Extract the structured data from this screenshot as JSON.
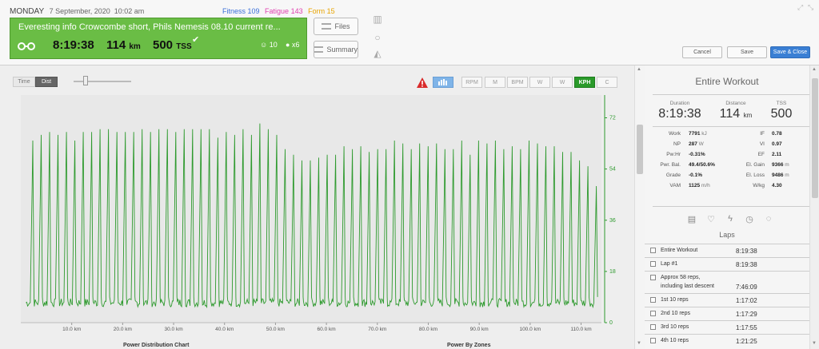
{
  "header": {
    "day": "MONDAY",
    "date": "7 September, 2020",
    "time": "10:02 am",
    "fitness_label": "Fitness 109",
    "fatigue_label": "Fatigue 143",
    "form_label": "Form 15",
    "fitness_color": "#3a6fd8",
    "fatigue_color": "#e040b0",
    "form_color": "#e8a400"
  },
  "workout": {
    "title": "Everesting info Crowcombe short, Phils Nemesis 08.10 current re...",
    "duration": "8:19:38",
    "distance": "114",
    "distance_unit": "km",
    "tss": "500",
    "tss_unit": "TSS",
    "check_mark": "✔",
    "rpe": "10",
    "comments": "x6",
    "accent_color": "#6abd45"
  },
  "buttons": {
    "files": "Files",
    "summary": "Summary",
    "cancel": "Cancel",
    "save": "Save",
    "save_close": "Save & Close"
  },
  "chart_toolbar": {
    "time": "Time",
    "dist": "Dist",
    "rpm": "RPM",
    "m": "M",
    "bpm": "BPM",
    "w1": "W",
    "w2": "W",
    "kph": "KPH",
    "c": "C"
  },
  "chart_footer": {
    "left": "Power Distribution Chart",
    "right": "Power By Zones"
  },
  "chart_data": {
    "type": "line",
    "series": [
      {
        "color": "#2e9a2e",
        "peaks_kph": [
          64,
          66,
          67,
          66,
          67,
          64,
          67,
          67,
          68,
          68,
          67,
          67,
          67,
          68,
          67,
          68,
          68,
          67,
          68,
          68,
          68,
          68,
          65,
          67,
          66,
          68,
          66,
          70,
          68,
          66,
          61,
          59,
          57,
          57,
          58,
          59,
          59,
          62,
          61,
          62,
          60,
          61,
          61,
          64,
          63,
          61,
          63,
          62,
          63,
          61,
          61,
          64,
          59,
          64,
          63,
          64,
          61,
          62,
          61,
          64,
          63,
          62,
          62,
          60,
          60,
          57,
          55,
          48
        ],
        "trough_kph": 7
      }
    ],
    "xlabel": "",
    "ylabel": "",
    "x_ticks": [
      "10.0 km",
      "20.0 km",
      "30.0 km",
      "40.0 km",
      "50.0 km",
      "60.0 km",
      "70.0 km",
      "80.0 km",
      "90.0 km",
      "100.0 km",
      "110.0 km"
    ],
    "x_tick_values": [
      10,
      20,
      30,
      40,
      50,
      60,
      70,
      80,
      90,
      100,
      110
    ],
    "xlim": [
      0,
      114
    ],
    "y_ticks": [
      "72",
      "54",
      "36",
      "18",
      "0"
    ],
    "y_tick_values": [
      72,
      54,
      36,
      18,
      0
    ],
    "ylim": [
      0,
      80
    ],
    "grid": false
  },
  "panel": {
    "title": "Entire Workout",
    "duration_label": "Duration",
    "duration": "8:19:38",
    "distance_label": "Distance",
    "distance": "114",
    "distance_unit": "km",
    "tss_label": "TSS",
    "tss": "500",
    "left_stats": [
      {
        "label": "Work",
        "value": "7791",
        "unit": "kJ"
      },
      {
        "label": "NP",
        "value": "287",
        "unit": "W"
      },
      {
        "label": "Pw:Hr",
        "value": "-0.31%",
        "unit": ""
      },
      {
        "label": "Pwr. Bal.",
        "value": "49.4/50.6%",
        "unit": ""
      },
      {
        "label": "Grade",
        "value": "-0.1%",
        "unit": ""
      },
      {
        "label": "VAM",
        "value": "1125",
        "unit": "m/h"
      }
    ],
    "right_stats": [
      {
        "label": "IF",
        "value": "0.78",
        "unit": ""
      },
      {
        "label": "VI",
        "value": "0.97",
        "unit": ""
      },
      {
        "label": "EF",
        "value": "2.11",
        "unit": ""
      },
      {
        "label": "El. Gain",
        "value": "9366",
        "unit": "m"
      },
      {
        "label": "El. Loss",
        "value": "9486",
        "unit": "m"
      },
      {
        "label": "W/kg",
        "value": "4.30",
        "unit": ""
      }
    ],
    "laps_title": "Laps",
    "laps": [
      {
        "name": "Entire Workout",
        "time": "8:19:38"
      },
      {
        "name": "Lap #1",
        "time": "8:19:38"
      },
      {
        "name": "Approx 58 reps,",
        "name2": "including last descent",
        "time": "7:46:09"
      },
      {
        "name": "1st 10 reps",
        "time": "1:17:02"
      },
      {
        "name": "2nd 10 reps",
        "time": "1:17:29"
      },
      {
        "name": "3rd 10 reps",
        "time": "1:17:55"
      },
      {
        "name": "4th 10 reps",
        "time": "1:21:25"
      }
    ]
  }
}
